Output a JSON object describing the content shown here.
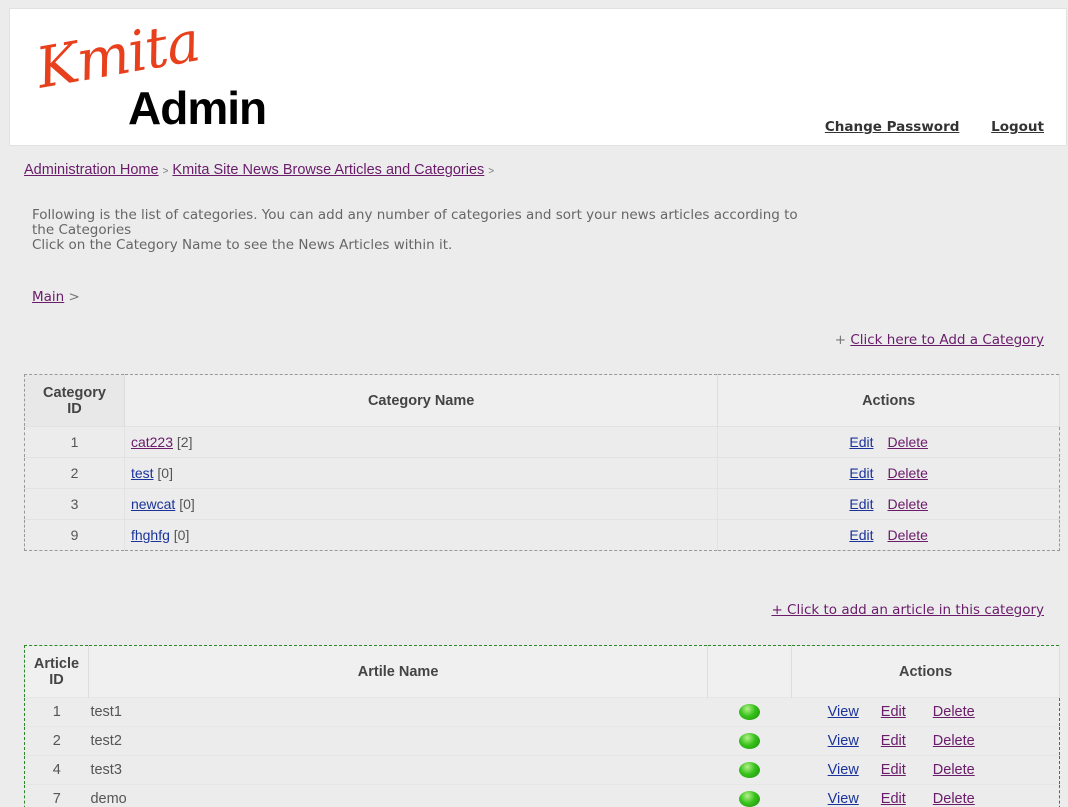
{
  "header": {
    "logo_script": "Kmita",
    "logo_admin": "Admin",
    "change_password": "Change Password",
    "logout": "Logout"
  },
  "breadcrumb": {
    "home": "Administration Home",
    "section": "Kmita Site News Browse Articles and Categories",
    "sep": ">"
  },
  "intro": {
    "line1": "Following is the list of categories. You can add any number of categories and sort your news articles according to",
    "line2": "the Categories",
    "line3": "Click on the Category Name to see the News Articles within it."
  },
  "sub_crumb": {
    "main": "Main",
    "sep": ">"
  },
  "add_category": {
    "prefix": "+",
    "link": "Click here to Add a Category"
  },
  "categories_table": {
    "headers": {
      "id_line1": "Category",
      "id_line2": "ID",
      "name": "Category Name",
      "actions": "Actions"
    },
    "rows": [
      {
        "id": "1",
        "name": "cat223",
        "count": "[2]",
        "edit": "Edit",
        "delete": "Delete"
      },
      {
        "id": "2",
        "name": "test",
        "count": "[0]",
        "edit": "Edit",
        "delete": "Delete"
      },
      {
        "id": "3",
        "name": "newcat",
        "count": "[0]",
        "edit": "Edit",
        "delete": "Delete"
      },
      {
        "id": "9",
        "name": "fhghfg",
        "count": "[0]",
        "edit": "Edit",
        "delete": "Delete"
      }
    ]
  },
  "add_article": {
    "link": "+ Click to add an article in this category"
  },
  "articles_table": {
    "headers": {
      "id_line1": "Article",
      "id_line2": "ID",
      "name": "Artile Name",
      "actions": "Actions"
    },
    "rows": [
      {
        "id": "1",
        "name": "test1",
        "view": "View",
        "edit": "Edit",
        "delete": "Delete"
      },
      {
        "id": "2",
        "name": "test2",
        "view": "View",
        "edit": "Edit",
        "delete": "Delete"
      },
      {
        "id": "4",
        "name": "test3",
        "view": "View",
        "edit": "Edit",
        "delete": "Delete"
      },
      {
        "id": "7",
        "name": "demo",
        "view": "View",
        "edit": "Edit",
        "delete": "Delete"
      }
    ],
    "status_icon": "green-status-dot-icon",
    "status_color": "#37c21b"
  }
}
